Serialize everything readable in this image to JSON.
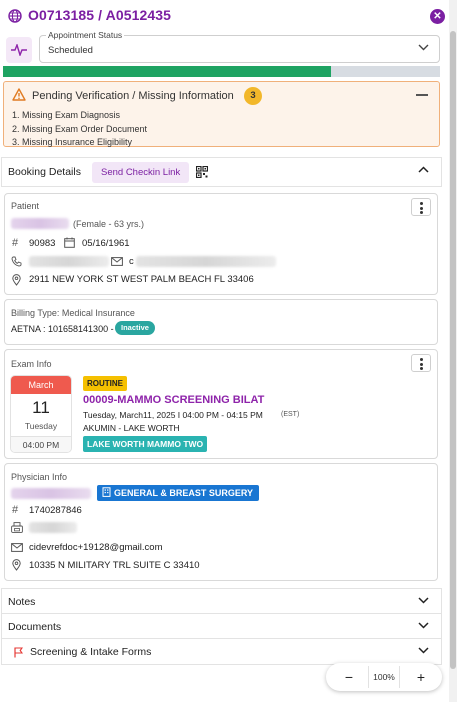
{
  "header": {
    "title": "O0713185 / A0512435",
    "icons": {
      "left": "globe-icon",
      "right": "close-icon"
    },
    "accent": "#7b1fa2"
  },
  "appointment_status": {
    "label": "Appointment Status",
    "value": "Scheduled"
  },
  "progress": {
    "fraction": 0.75,
    "fill_color": "#1ea362"
  },
  "pending": {
    "title": "Pending Verification / Missing Information",
    "count": "3",
    "items": [
      "1. Missing Exam Diagnosis",
      "2. Missing Exam Order Document",
      "3. Missing Insurance Eligibility"
    ]
  },
  "booking": {
    "title": "Booking Details",
    "checkin_button": "Send Checkin Link"
  },
  "patient": {
    "title": "Patient",
    "demographics": "(Female - 63 yrs.)",
    "id": "90983",
    "dob": "05/16/1961",
    "email_visible": "c",
    "address": "2911 NEW YORK ST WEST PALM BEACH FL 33406"
  },
  "billing": {
    "type": "Billing Type: Medical Insurance",
    "insurance": "AETNA : 101658141300 -",
    "status": "Inactive"
  },
  "exam": {
    "title": "Exam Info",
    "month": "March",
    "day": "11",
    "weekday": "Tuesday",
    "time": "04:00 PM",
    "priority": "ROUTINE",
    "name": "00009-MAMMO SCREENING BILAT",
    "schedule": "Tuesday, March11, 2025  I  04:00 PM - 04:15 PM",
    "timezone": "(EST)",
    "provider": "AKUMIN - LAKE WORTH",
    "location": "LAKE WORTH MAMMO TWO"
  },
  "physician": {
    "title": "Physician Info",
    "specialty": "GENERAL & BREAST SURGERY",
    "npi": "1740287846",
    "email": "cidevrefdoc+19128@gmail.com",
    "address": "10335 N MILITARY TRL SUITE C 33410"
  },
  "sections": {
    "notes": "Notes",
    "documents": "Documents",
    "screening": "Screening & Intake Forms"
  },
  "zoom": {
    "minus": "−",
    "value": "100%",
    "plus": "+"
  }
}
